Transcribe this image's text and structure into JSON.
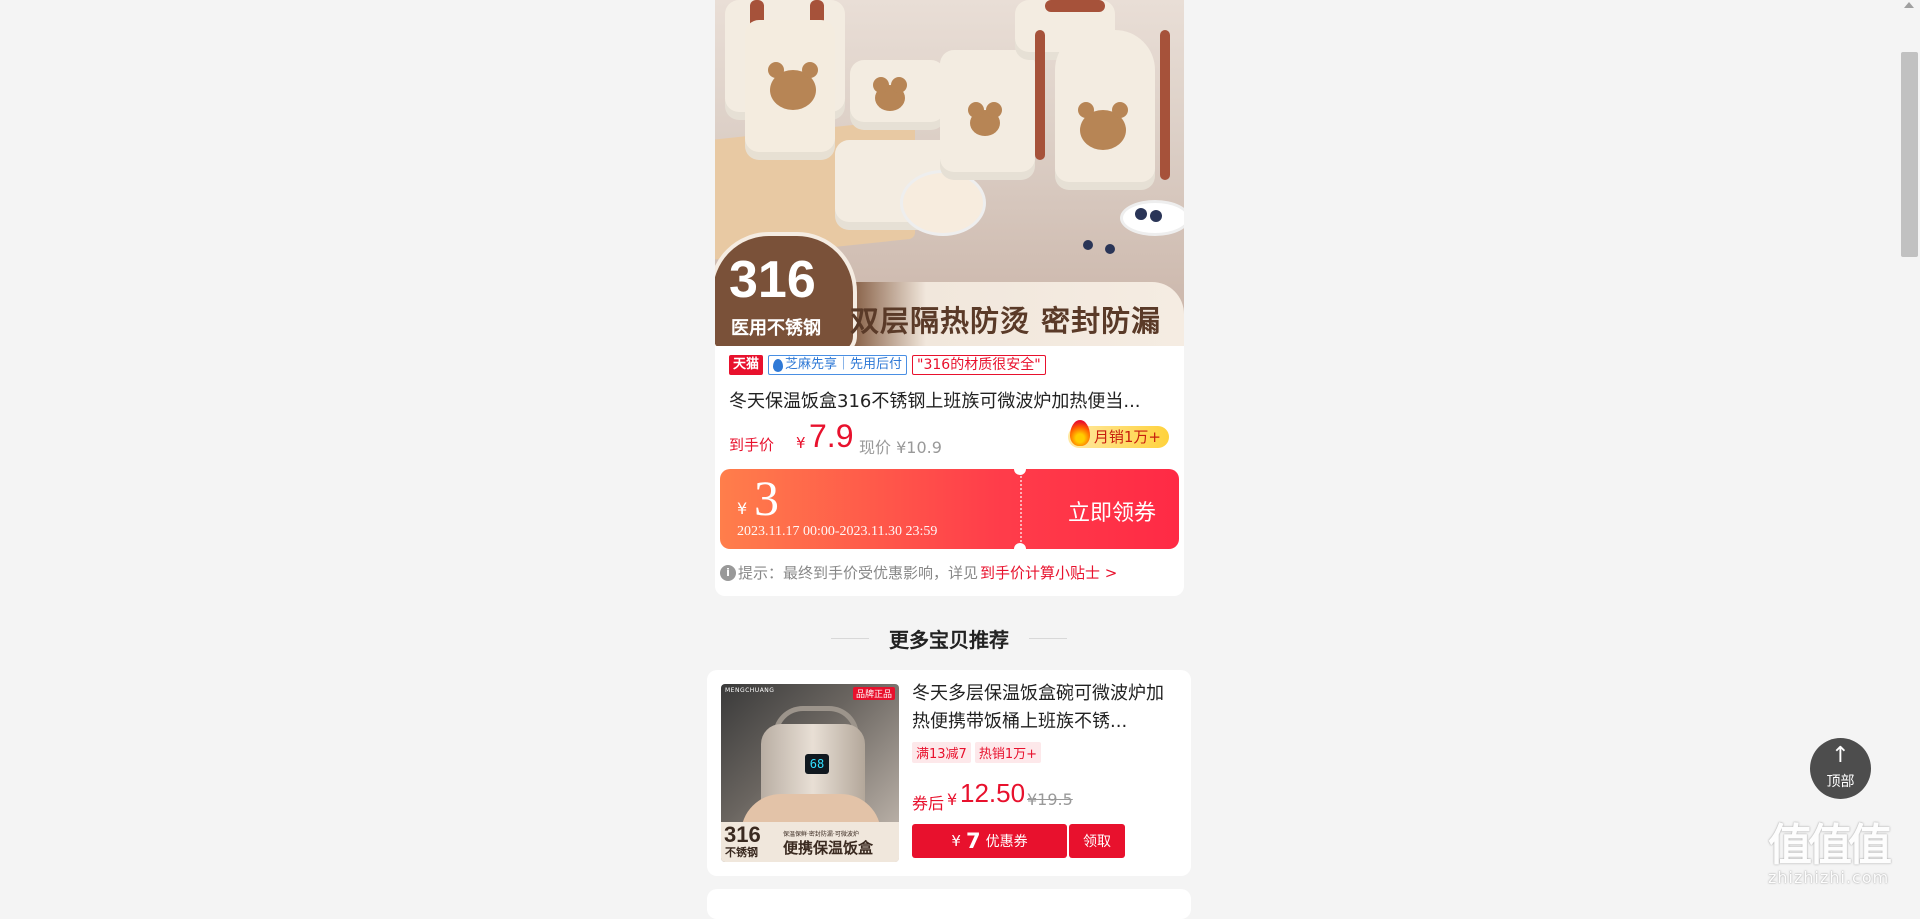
{
  "product": {
    "hero": {
      "badge_number": "316",
      "badge_text": "医用不锈钢",
      "slogan": "双层隔热防烫 密封防漏"
    },
    "tags": {
      "tmall": "天猫",
      "zhima": "芝麻先享｜先用后付",
      "quote": "\"316的材质很安全\""
    },
    "title": "冬天保温饭盒316不锈钢上班族可微波炉加热便当...",
    "price": {
      "label": "到手价",
      "currency": "¥",
      "value": "7.9",
      "now": "现价 ¥10.9"
    },
    "sales": "月销1万+",
    "coupon": {
      "currency": "¥",
      "amount": "3",
      "period": "2023.11.17 00:00-2023.11.30 23:59",
      "claim": "立即领券"
    },
    "tip": {
      "text": "提示：最终到手价受优惠影响，详见",
      "link": "到手价计算小贴士 >"
    }
  },
  "section": {
    "title": "更多宝贝推荐"
  },
  "recommendations": [
    {
      "image": {
        "brand": "MENGCHUANG",
        "ribbon": "品牌正品",
        "lcd": "68",
        "big": "316",
        "steel": "不锈钢",
        "small": "保温保鲜·密封防漏·可微波炉",
        "caption": "便携保温饭盒"
      },
      "title": "冬天多层保温饭盒碗可微波炉加热便携带饭桶上班族不锈...",
      "tags": [
        "满13减7",
        "热销1万+"
      ],
      "price_label": "券后",
      "currency": "¥",
      "price": "12.50",
      "original": "¥19.5",
      "coupon_currency": "¥",
      "coupon_amount": "7",
      "coupon_word": "优惠券",
      "claim": "领取"
    }
  ],
  "back_to_top": {
    "arrow": "↑",
    "label": "顶部"
  },
  "watermark": {
    "big": "值值值",
    "small": "zhizhizhi.com"
  }
}
